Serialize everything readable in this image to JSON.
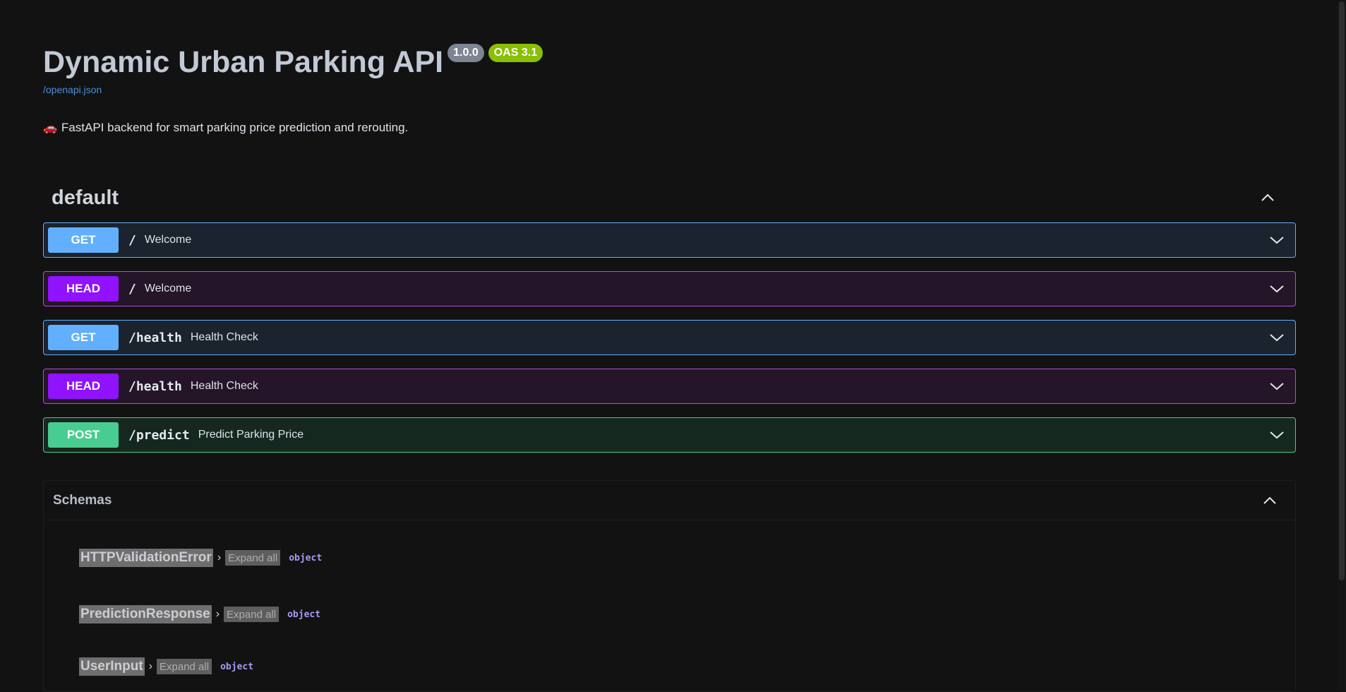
{
  "info": {
    "title": "Dynamic Urban Parking API",
    "version": "1.0.0",
    "oas": "OAS 3.1",
    "spec_link": "/openapi.json",
    "description": "FastAPI backend for smart parking price prediction and rerouting.",
    "description_icon": "🚗"
  },
  "tag": {
    "name": "default"
  },
  "operations": [
    {
      "method": "GET",
      "path": "/",
      "summary": "Welcome"
    },
    {
      "method": "HEAD",
      "path": "/",
      "summary": "Welcome"
    },
    {
      "method": "GET",
      "path": "/health",
      "summary": "Health Check"
    },
    {
      "method": "HEAD",
      "path": "/health",
      "summary": "Health Check"
    },
    {
      "method": "POST",
      "path": "/predict",
      "summary": "Predict Parking Price"
    }
  ],
  "schemas": {
    "title": "Schemas",
    "expand_label": "Expand all",
    "models": [
      {
        "name": "HTTPValidationError",
        "type": "object"
      },
      {
        "name": "PredictionResponse",
        "type": "object"
      },
      {
        "name": "UserInput",
        "type": "object"
      }
    ]
  },
  "colors": {
    "get": "#61affe",
    "head": "#9012fe",
    "post": "#49cc90",
    "version_badge": "#7d8492",
    "oas_badge": "#89bf04"
  }
}
